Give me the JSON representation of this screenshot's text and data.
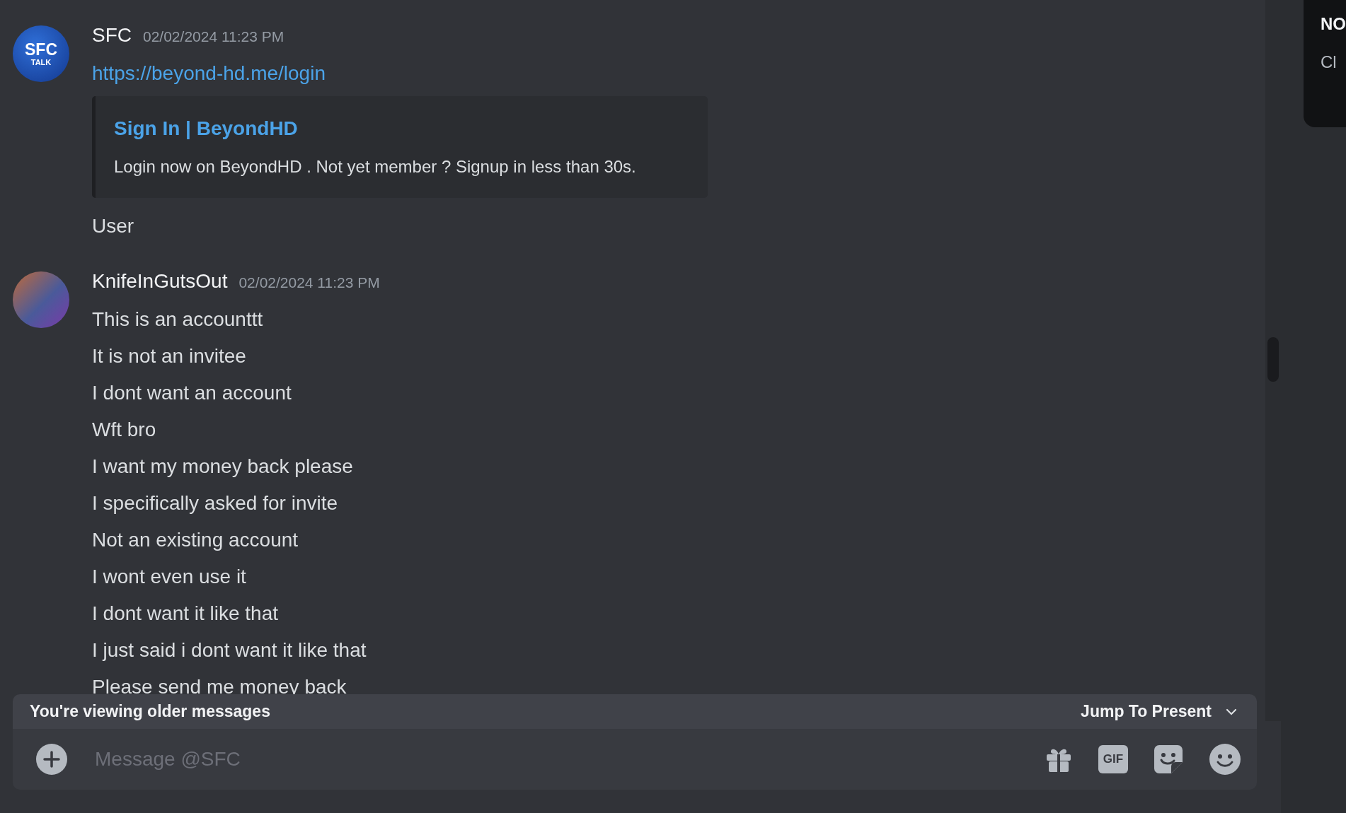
{
  "messages": [
    {
      "author": "SFC",
      "timestamp": "02/02/2024 11:23 PM",
      "avatar": {
        "kind": "logo",
        "lines": [
          "SFC",
          "TALK"
        ]
      },
      "content": [
        {
          "kind": "link",
          "text": "https://beyond-hd.me/login"
        },
        {
          "kind": "embed",
          "title": "Sign In | BeyondHD",
          "description": "Login now on BeyondHD . Not yet member ? Signup in less than 30s."
        },
        {
          "kind": "text",
          "text": "User"
        }
      ]
    },
    {
      "author": "KnifeInGutsOut",
      "timestamp": "02/02/2024 11:23 PM",
      "avatar": {
        "kind": "picture"
      },
      "content": [
        {
          "kind": "text",
          "text": "This is an accounttt"
        },
        {
          "kind": "text",
          "text": "It is not an invitee"
        },
        {
          "kind": "text",
          "text": "I dont want an account"
        },
        {
          "kind": "text",
          "text": "Wft bro"
        },
        {
          "kind": "text",
          "text": "I want my money back please"
        },
        {
          "kind": "text",
          "text": "I specifically asked for invite"
        },
        {
          "kind": "text",
          "text": "Not an existing account"
        },
        {
          "kind": "text",
          "text": "I wont even use it"
        },
        {
          "kind": "text",
          "text": "I dont want it like that"
        },
        {
          "kind": "text",
          "text": "I just said i dont want it like that"
        },
        {
          "kind": "text",
          "text": "Please send me money back"
        }
      ]
    }
  ],
  "older_bar": {
    "notice": "You're viewing older messages",
    "jump_button": "Jump To Present"
  },
  "composer": {
    "placeholder": "Message @SFC",
    "gif_label": "GIF"
  },
  "side_popup": {
    "title": "NO",
    "line": "Cl"
  }
}
